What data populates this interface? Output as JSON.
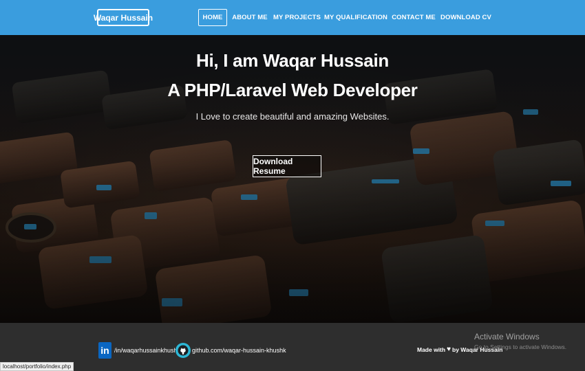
{
  "navbar": {
    "brand": "Waqar Hussain",
    "items": [
      {
        "label": "HOME",
        "active": true
      },
      {
        "label": "ABOUT ME",
        "active": false
      },
      {
        "label": "MY PROJECTS",
        "active": false
      },
      {
        "label": "MY QUALIFICATION",
        "active": false
      },
      {
        "label": "CONTACT ME",
        "active": false
      },
      {
        "label": "DOWNLOAD CV",
        "active": false
      }
    ],
    "background_color": "#3a9dde"
  },
  "hero": {
    "greeting": "Hi, I am Waqar Hussain",
    "role": "A PHP/Laravel Web Developer",
    "tagline": "I Love to create beautiful and amazing Websites.",
    "button_label": "Download Resume",
    "background": "keyboard-photo"
  },
  "footer": {
    "linkedin_text": "/in/waqarhussainkhushk",
    "github_text": "github.com/waqar-hussain-khushk",
    "made_with_prefix": "Made with",
    "made_with_suffix": "by Waqar Hussain",
    "heart_icon": "heart-icon"
  },
  "os_watermark": {
    "title": "Activate Windows",
    "subtitle": "Go to Settings to activate Windows."
  },
  "status_bar": {
    "url": "localhost/portfolio/index.php"
  }
}
